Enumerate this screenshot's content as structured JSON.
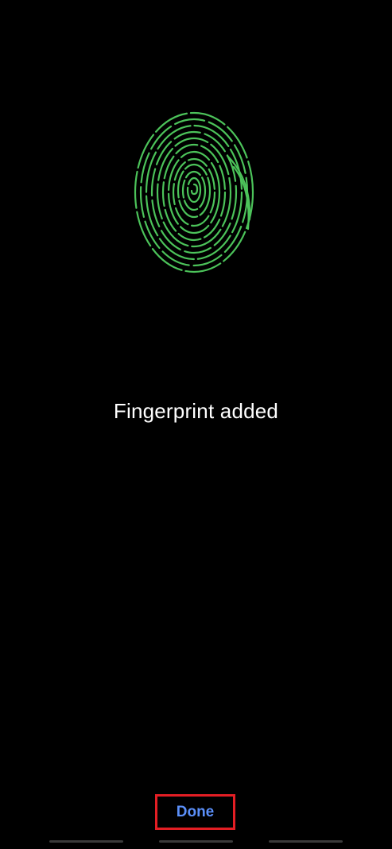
{
  "screen": {
    "status_title": "Fingerprint added",
    "done_label": "Done"
  },
  "icons": {
    "fingerprint": "fingerprint-icon"
  },
  "colors": {
    "background": "#000000",
    "fingerprint_stroke": "#4cc35a",
    "title_text": "#ffffff",
    "done_text": "#5b8ff9",
    "highlight_border": "#e31e24",
    "nav_handle": "#3a3a3a"
  }
}
